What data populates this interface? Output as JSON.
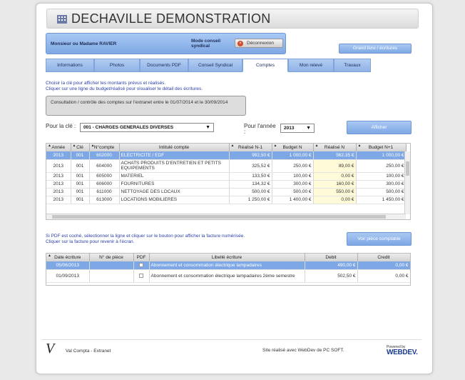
{
  "app": {
    "title": "DECHAVILLE DEMONSTRATION"
  },
  "userbar": {
    "user": "Monsieur ou Madame RAVIER",
    "mode_line1": "Mode conseil",
    "mode_line2": "syndical",
    "logout_label": "Déconnexion"
  },
  "grand_livre_label": "Grand livre / écritures",
  "tabs": [
    {
      "label": "Informations"
    },
    {
      "label": "Photos"
    },
    {
      "label": "Documents PDF"
    },
    {
      "label": "Conseil Syndical"
    },
    {
      "label": "Comptes"
    },
    {
      "label": "Mon relevé"
    },
    {
      "label": "Travaux"
    }
  ],
  "active_tab": "Comptes",
  "instructions": {
    "line1": "Choisir la clé pour afficher les montants prévus et réalisés.",
    "line2": "Cliquer sur une ligne du budget/réalisé pour visualiser le détail des écritures."
  },
  "notice": "Consultation / contrôle des comptes sur l'extranet entre le 01/07/2014 et le 30/09/2014",
  "filters": {
    "cle_label": "Pour la clé :",
    "cle_value": "001 - CHARGES GENERALES DIVERSES",
    "annee_label": "Pour l'année",
    "annee_colon": ":",
    "annee_value": "2013",
    "afficher_label": "Afficher"
  },
  "budget_table": {
    "headers": [
      "Année",
      "Clé",
      "N°compte",
      "Intitulé compte",
      "Réalisé N-1",
      "Budget N",
      "Réalisé N",
      "Budget N+1"
    ],
    "rows": [
      [
        "2013",
        "001",
        "602000",
        "ELECTRICITE / EDF",
        "992,50 €",
        "1 000,00 €",
        "562,35 €",
        "1 000,00 €"
      ],
      [
        "2013",
        "001",
        "604000",
        "ACHATS PRODUITS D'ENTRETIEN ET PETITS EQUIPEMENTS",
        "325,52 €",
        "250,00 €",
        "89,00 €",
        "250,00 €"
      ],
      [
        "2013",
        "001",
        "605000",
        "MATERIEL",
        "133,50 €",
        "100,00 €",
        "0,00 €",
        "100,00 €"
      ],
      [
        "2013",
        "001",
        "606000",
        "FOURNITURES",
        "134,32 €",
        "300,00 €",
        "160,00 €",
        "300,00 €"
      ],
      [
        "2013",
        "001",
        "611000",
        "NETTOYAGE DES LOCAUX",
        "500,00 €",
        "500,00 €",
        "550,00 €",
        "500,00 €"
      ],
      [
        "2013",
        "001",
        "613000",
        "LOCATIONS MOBILIERES",
        "1 250,00 €",
        "1 400,00 €",
        "0,00 €",
        "1 450,00 €"
      ]
    ],
    "selected_row": 0
  },
  "pdf_instructions": {
    "line1": "Si PDF est coché, sélectionner la ligne et cliquer sur le bouton pour afficher la facture numérisée.",
    "line2": "Cliquer sur la facture pour revenir à l'écran."
  },
  "voir_piece_label": "Voir pièce comptable",
  "ecritures_table": {
    "headers": [
      "Date écriture",
      "N° de pièce",
      "PDF",
      "Libellé écriture",
      "Debit",
      "Credit"
    ],
    "rows": [
      [
        "05/06/2013",
        "",
        "",
        "Abonnement et consommation électrique lampadaires",
        "490,00 €",
        "0,00 €"
      ],
      [
        "01/09/2013",
        "",
        "",
        "Abonnement et consommation électrique lampadaires 2ème semestre",
        "502,50 €",
        "0,00 €"
      ]
    ],
    "selected_row": 0
  },
  "footer": {
    "logo_letter": "V",
    "app_name": "Val Compta - Extranet",
    "credit": "Site réalisé avec WebDev de PC SOFT.",
    "powered_small": "Powered by",
    "powered_brand": "WEBDEV."
  },
  "colors": {
    "accent": "#7ea8e5",
    "link_text": "#2b3fa8",
    "highlight_yellow": "#fffbd8",
    "logout_icon": "#d34a2a"
  }
}
